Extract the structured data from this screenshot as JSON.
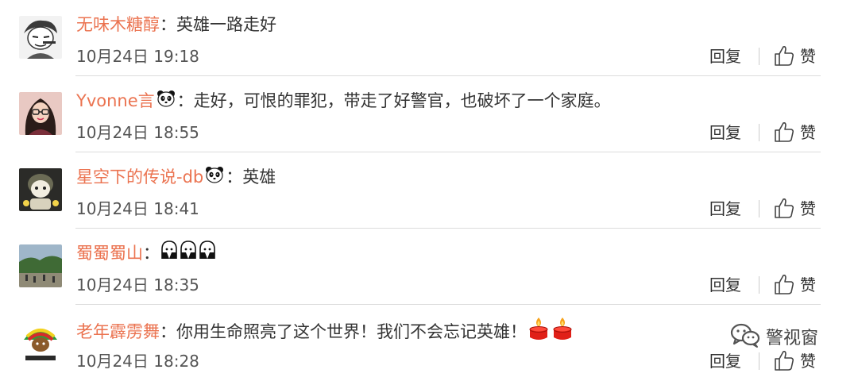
{
  "colors": {
    "username": "#eb7350",
    "text": "#333333",
    "meta": "#555555",
    "divider": "#dcdcdc"
  },
  "comments": [
    {
      "username": "无味木糖醇",
      "colon": "：",
      "content": "英雄一路走好",
      "badges": [],
      "emojis": [],
      "timestamp": "10月24日 19:18",
      "reply_label": "回复",
      "like_label": "赞"
    },
    {
      "username": "Yvonne言",
      "colon": "：",
      "content": "走好，可恨的罪犯，带走了好警官，也破坏了一个家庭。",
      "badges": [
        "panda-badge-icon"
      ],
      "emojis": [],
      "timestamp": "10月24日 18:55",
      "reply_label": "回复",
      "like_label": "赞"
    },
    {
      "username": "星空下的传说-db",
      "colon": "：",
      "content": "英雄",
      "badges": [
        "panda-badge-icon"
      ],
      "emojis": [],
      "timestamp": "10月24日 18:41",
      "reply_label": "回复",
      "like_label": "赞"
    },
    {
      "username": "蜀蜀蜀山",
      "colon": "：",
      "content": "",
      "badges": [],
      "emojis": [
        "mourning-emoji-icon",
        "mourning-emoji-icon",
        "mourning-emoji-icon"
      ],
      "timestamp": "10月24日 18:35",
      "reply_label": "回复",
      "like_label": "赞"
    },
    {
      "username": "老年霹雳舞",
      "colon": "：",
      "content": "你用生命照亮了这个世界！我们不会忘记英雄！",
      "badges": [],
      "emojis": [
        "candle-emoji-icon",
        "candle-emoji-icon"
      ],
      "timestamp": "10月24日 18:28",
      "reply_label": "回复",
      "like_label": "赞"
    }
  ],
  "watermark": {
    "text": "警视窗",
    "icon": "wechat-logo-icon"
  }
}
